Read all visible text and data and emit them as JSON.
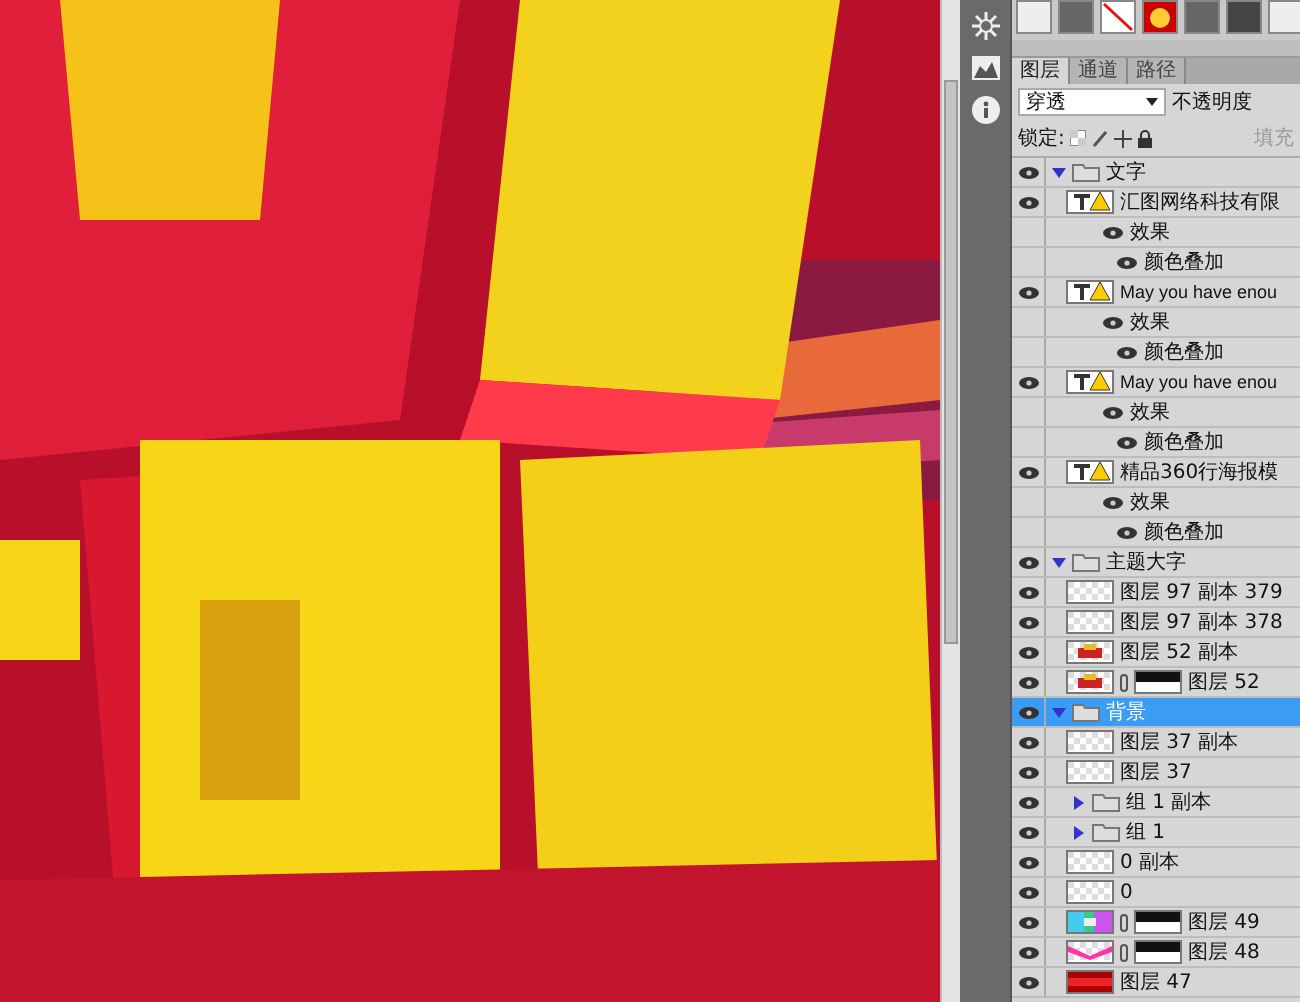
{
  "panel": {
    "tabs": [
      {
        "label": "图层",
        "selected": true
      },
      {
        "label": "通道",
        "selected": false
      },
      {
        "label": "路径",
        "selected": false
      }
    ],
    "blend_mode": "穿透",
    "opacity_label": "不透明度",
    "lock_label": "锁定:",
    "fill_label": "填充",
    "layers": [
      {
        "kind": "group",
        "name": "文字",
        "expanded": true,
        "selected": false,
        "children": [
          {
            "kind": "text",
            "name": "汇图网络科技有限",
            "selected": false,
            "children": [
              {
                "kind": "effects",
                "name": "效果",
                "selected": false,
                "children": [
                  {
                    "kind": "effect",
                    "name": "颜色叠加",
                    "selected": false
                  }
                ]
              }
            ]
          },
          {
            "kind": "text",
            "name": "May you have enou",
            "selected": false,
            "children": [
              {
                "kind": "effects",
                "name": "效果",
                "selected": false,
                "children": [
                  {
                    "kind": "effect",
                    "name": "颜色叠加",
                    "selected": false
                  }
                ]
              }
            ]
          },
          {
            "kind": "text",
            "name": "May you have enou",
            "selected": false,
            "children": [
              {
                "kind": "effects",
                "name": "效果",
                "selected": false,
                "children": [
                  {
                    "kind": "effect",
                    "name": "颜色叠加",
                    "selected": false
                  }
                ]
              }
            ]
          },
          {
            "kind": "text",
            "name": "精品360行海报模",
            "selected": false,
            "children": [
              {
                "kind": "effects",
                "name": "效果",
                "selected": false,
                "children": [
                  {
                    "kind": "effect",
                    "name": "颜色叠加",
                    "selected": false
                  }
                ]
              }
            ]
          }
        ]
      },
      {
        "kind": "group",
        "name": "主题大字",
        "expanded": true,
        "selected": false,
        "children": [
          {
            "kind": "pixel",
            "name": "图层 97 副本 379",
            "thumbnail": {
              "kind": "clear"
            },
            "mask": false,
            "selected": false
          },
          {
            "kind": "pixel",
            "name": "图层 97 副本 378",
            "thumbnail": {
              "kind": "clear"
            },
            "mask": false,
            "selected": false
          },
          {
            "kind": "pixel",
            "name": "图层 52 副本",
            "thumbnail": {
              "kind": "emblem"
            },
            "mask": false,
            "selected": false
          },
          {
            "kind": "pixel",
            "name": "图层 52",
            "thumbnail": {
              "kind": "emblem"
            },
            "mask": true,
            "selected": false
          }
        ]
      },
      {
        "kind": "group",
        "name": "背景",
        "expanded": true,
        "selected": true,
        "children": [
          {
            "kind": "pixel",
            "name": "图层 37 副本",
            "thumbnail": {
              "kind": "clear"
            },
            "mask": false,
            "selected": false
          },
          {
            "kind": "pixel",
            "name": "图层 37",
            "thumbnail": {
              "kind": "clear"
            },
            "mask": false,
            "selected": false
          },
          {
            "kind": "group",
            "name": "组 1 副本",
            "expanded": false,
            "selected": false
          },
          {
            "kind": "group",
            "name": "组 1",
            "expanded": false,
            "selected": false
          },
          {
            "kind": "pixel",
            "name": "0 副本",
            "thumbnail": {
              "kind": "clear"
            },
            "mask": false,
            "selected": false
          },
          {
            "kind": "pixel",
            "name": "0",
            "thumbnail": {
              "kind": "clear"
            },
            "mask": false,
            "selected": false
          },
          {
            "kind": "pixel",
            "name": "图层 49",
            "thumbnail": {
              "kind": "rainbow"
            },
            "mask": true,
            "selected": false
          },
          {
            "kind": "pixel",
            "name": "图层 48",
            "thumbnail": {
              "kind": "ribbon"
            },
            "mask": true,
            "selected": false
          },
          {
            "kind": "pixel",
            "name": "图层 47",
            "thumbnail": {
              "kind": "crimson"
            },
            "mask": false,
            "selected": false
          }
        ]
      }
    ]
  }
}
